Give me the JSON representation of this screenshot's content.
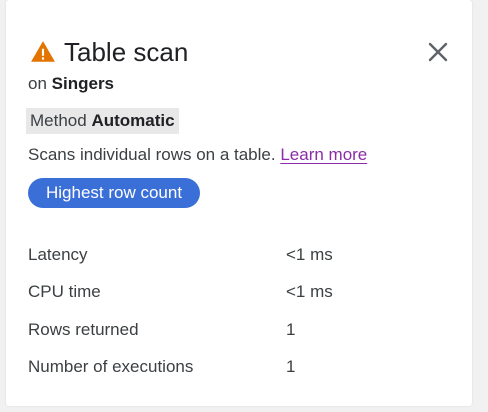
{
  "panel": {
    "title": "Table scan",
    "icon": "warning-icon",
    "warning_color": "#e37400",
    "on_prefix": "on",
    "on_table": "Singers",
    "method_label": "Method",
    "method_value": "Automatic",
    "description": "Scans individual rows on a table.",
    "learn_more": "Learn more",
    "badge": "Highest row count",
    "accent_color": "#3b6fd8"
  },
  "metrics": [
    {
      "label": "Latency",
      "value": "<1 ms"
    },
    {
      "label": "CPU time",
      "value": "<1 ms"
    },
    {
      "label": "Rows returned",
      "value": "1"
    },
    {
      "label": "Number of executions",
      "value": "1"
    }
  ]
}
